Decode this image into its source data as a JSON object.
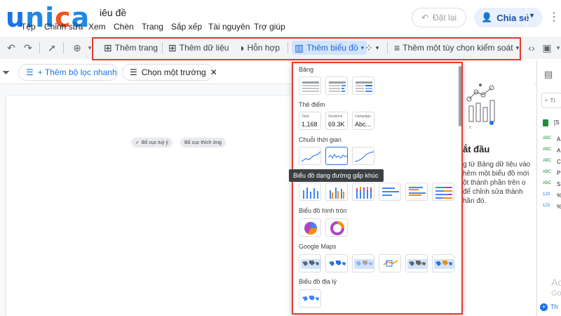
{
  "app": {
    "doc_title": "iêu đề",
    "menu": [
      "Tệp",
      "Chỉnh sửa",
      "Xem",
      "Chèn",
      "Trang",
      "Sắp xếp",
      "Tài nguyên",
      "Trợ giúp"
    ],
    "reset_label": "Đặt lại",
    "share_label": "Chia sẻ"
  },
  "toolbar": {
    "add_page": "Thêm trang",
    "add_data": "Thêm dữ liệu",
    "blend": "Hỗn hợp",
    "add_chart": "Thêm biểu đồ",
    "add_control": "Thêm một tùy chọn kiểm soát"
  },
  "filterbar": {
    "add_quick_filter": "+ Thêm bộ lọc nhanh",
    "choose_field": "Chọn một trường"
  },
  "canvas": {
    "chip_custom_layout": "Bố cục tuỳ ý",
    "chip_responsive_layout": "Bố cục thích ứng"
  },
  "chart_menu": {
    "sections": {
      "table": "Bảng",
      "scorecard": "Thẻ điểm",
      "timeseries": "Chuỗi thời gian",
      "pie": "Biểu đồ hình tròn",
      "google_maps": "Google Maps",
      "geo": "Biểu đồ địa lý"
    },
    "scorecards": [
      {
        "label": "Total",
        "value": "1,168"
      },
      {
        "label": "Sessions",
        "value": "69.3K"
      },
      {
        "label": "Campaign",
        "value": "Abc..."
      }
    ],
    "tooltip": "Biểu đồ dạng đường gấp khúc"
  },
  "right_panel": {
    "start_title": "ắt đầu",
    "start_text": "g từ Bảng dữ liệu vào hêm một biểu đồ mới ột thành phần trên o để chỉnh sửa thành hần đó."
  },
  "side_panel": {
    "search_placeholder": "Tì",
    "rows": [
      {
        "type": "",
        "label": "[S"
      },
      {
        "type": "ABC",
        "label": "A"
      },
      {
        "type": "ABC",
        "label": "A"
      },
      {
        "type": "ABC",
        "label": "C"
      },
      {
        "type": "ABC",
        "label": "P"
      },
      {
        "type": "ABC",
        "label": "S"
      },
      {
        "type": "123",
        "label": "%"
      },
      {
        "type": "123",
        "label": "%"
      }
    ],
    "footer_text": "Th",
    "watermark_1": "Ac",
    "watermark_2": "Go"
  }
}
